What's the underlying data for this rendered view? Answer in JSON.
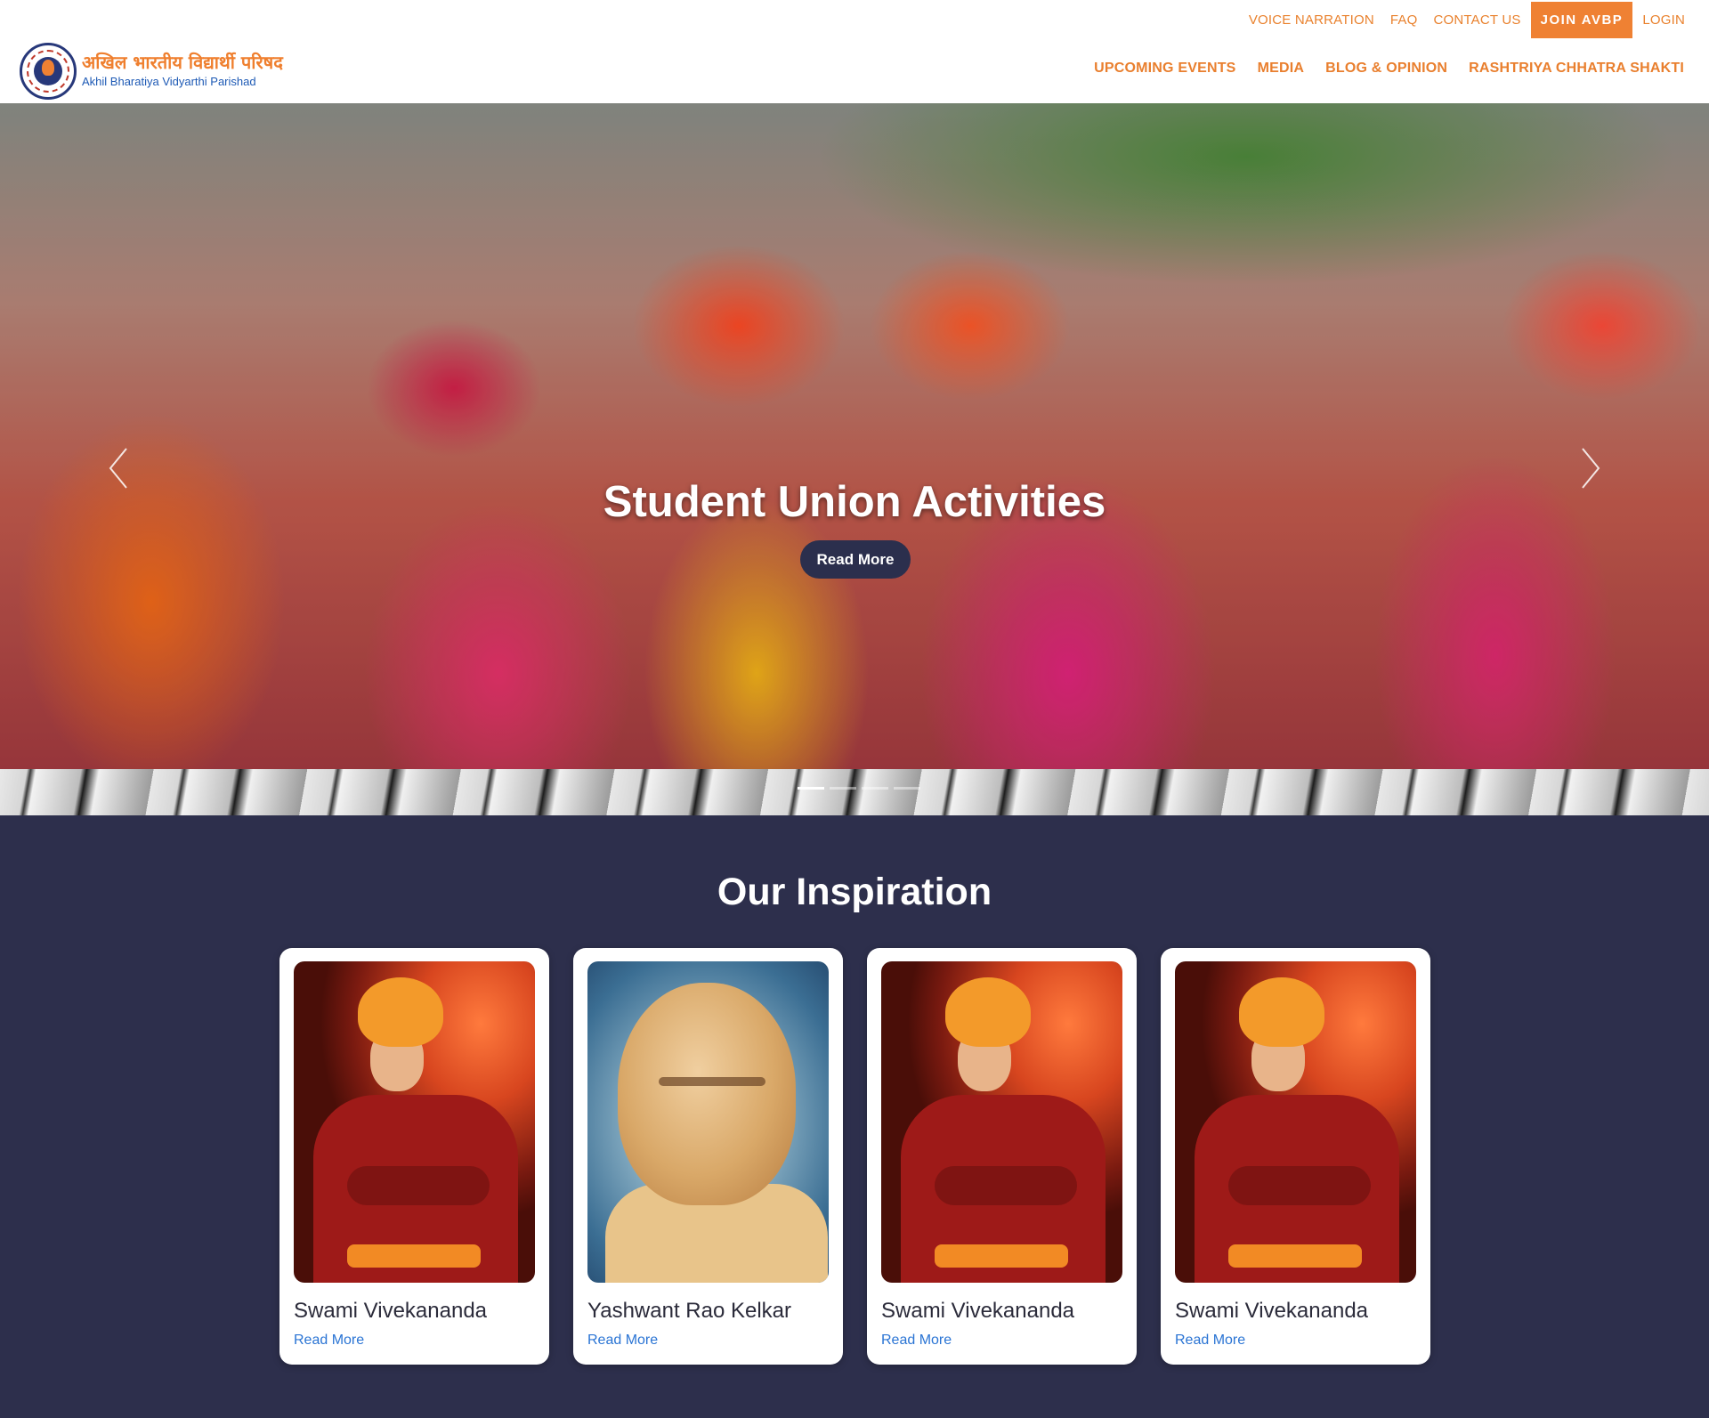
{
  "topbar": {
    "links": [
      "VOICE NARRATION",
      "FAQ",
      "CONTACT US"
    ],
    "join_label": "JOIN AVBP",
    "login_label": "LOGIN"
  },
  "logo": {
    "hindi": "अखिल भारतीय विद्यार्थी परिषद",
    "english": "Akhil Bharatiya Vidyarthi Parishad"
  },
  "nav": {
    "items": [
      "UPCOMING EVENTS",
      "MEDIA",
      "BLOG & OPINION",
      "RASHTRIYA CHHATRA SHAKTI"
    ]
  },
  "hero": {
    "title": "Student Union Activities",
    "button": "Read More",
    "slide_count": 4,
    "active_slide": 1
  },
  "inspiration": {
    "title": "Our Inspiration",
    "cards": [
      {
        "name": "Swami Vivekananda",
        "link": "Read More"
      },
      {
        "name": "Yashwant Rao Kelkar",
        "link": "Read More"
      },
      {
        "name": "Swami Vivekananda",
        "link": "Read More"
      },
      {
        "name": "Swami Vivekananda",
        "link": "Read More"
      }
    ]
  },
  "colors": {
    "accent": "#ef8133",
    "section_bg": "#2d2f4c",
    "link": "#2a74d4"
  },
  "icons": [
    "chevron-left-icon",
    "chevron-right-icon",
    "logo-emblem-icon"
  ]
}
